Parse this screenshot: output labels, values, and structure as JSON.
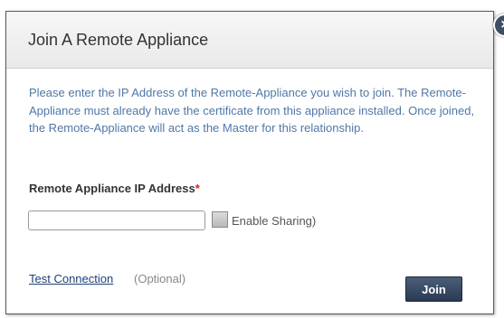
{
  "dialog": {
    "title": "Join A Remote Appliance",
    "close_glyph": "×",
    "description": "Please enter the IP Address of the Remote-Appliance you wish to join. The Remote-Appliance must already have the certificate from this appliance installed. Once joined, the Remote-Appliance will act as the Master for this relationship."
  },
  "form": {
    "ip_label": "Remote Appliance IP Address",
    "required_marker": "*",
    "ip_value": "",
    "ip_placeholder": "",
    "sharing_label": "Enable Sharing)",
    "sharing_checked": false
  },
  "footer": {
    "test_link": "Test Connection",
    "optional_text": "(Optional)",
    "join_label": "Join"
  },
  "colors": {
    "description_text": "#4f77a8",
    "required": "#d32020",
    "button": "#2f3f57"
  },
  "icons": {
    "close": "close-icon"
  }
}
